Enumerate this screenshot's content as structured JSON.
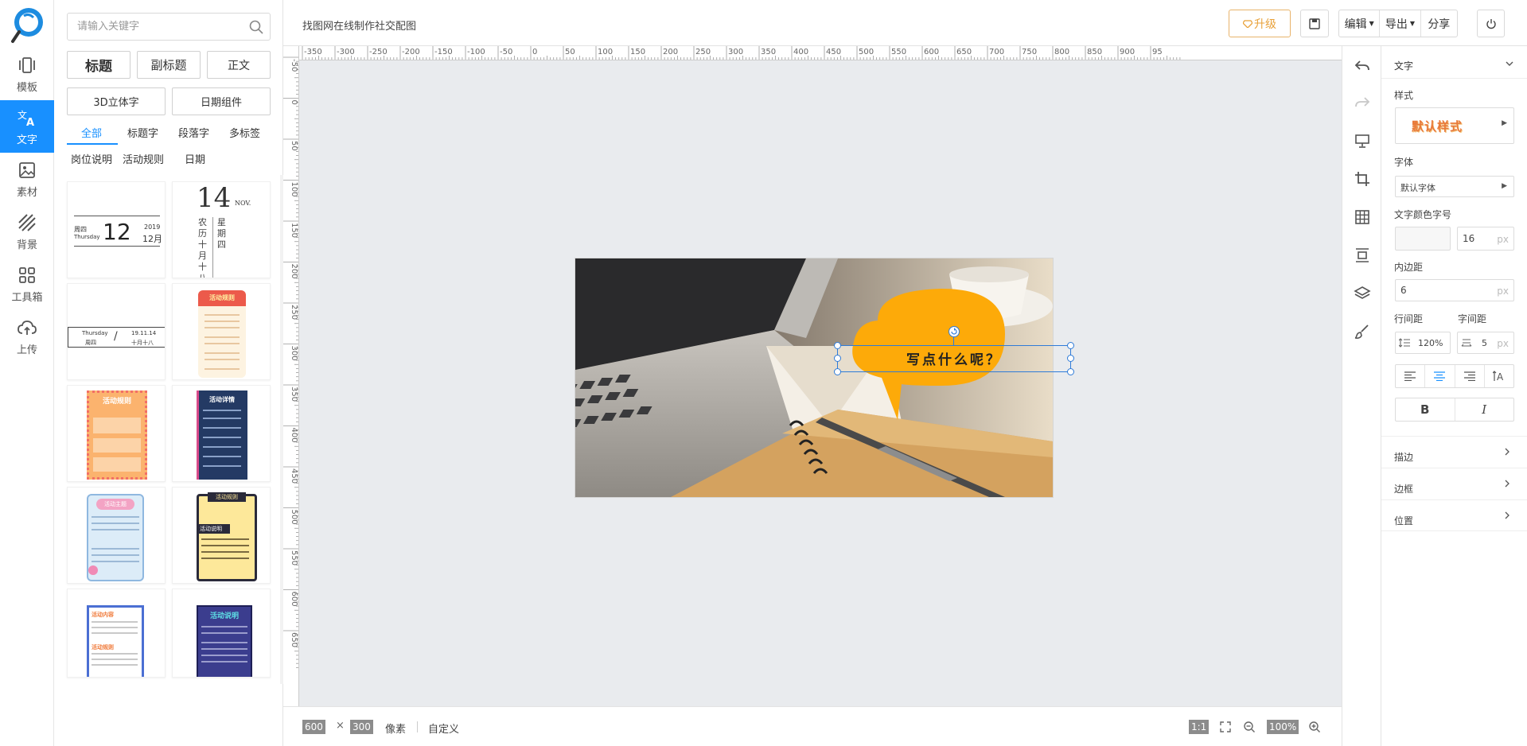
{
  "nav": {
    "items": [
      {
        "label": "模板",
        "icon": "template-icon"
      },
      {
        "label": "文字",
        "icon": "text-translate-icon",
        "active": true
      },
      {
        "label": "素材",
        "icon": "image-icon"
      },
      {
        "label": "背景",
        "icon": "background-stripes-icon"
      },
      {
        "label": "工具箱",
        "icon": "grid-toolbox-icon"
      },
      {
        "label": "上传",
        "icon": "cloud-upload-icon"
      }
    ]
  },
  "panel": {
    "search_placeholder": "请输入关键字",
    "buttons": {
      "title": "标题",
      "subtitle": "副标题",
      "body": "正文",
      "text3d": "3D立体字",
      "date": "日期组件"
    },
    "categories": [
      "全部",
      "标题字",
      "段落字",
      "多标签",
      "岗位说明",
      "活动规则",
      "日期"
    ],
    "active_category": "全部",
    "card1": {
      "weekday_cn": "周四",
      "weekday_en": "Thursday",
      "day": "12",
      "year": "2019",
      "month": "12月"
    },
    "card2": {
      "day": "14",
      "month": "NOV.",
      "lunar": "农历十月十八",
      "week": "星期四"
    },
    "card3": {
      "weekday_en": "Thursday",
      "weekday_cn": "周四",
      "date": "19.11.14",
      "lunar": "十月十八"
    },
    "card4": {
      "title": "活动规则"
    },
    "card5": {
      "title": "活动规则"
    },
    "card6": {
      "title": "活动详情"
    },
    "card7": {
      "title": "活动主题"
    },
    "card8": {
      "title": "活动规则",
      "section": "活动说明"
    },
    "card9": {
      "title": "活动内容",
      "section": "活动规则"
    },
    "card10": {
      "title": "活动说明"
    }
  },
  "topbar": {
    "doc_title": "找图网在线制作社交配图",
    "upgrade": "升级",
    "edit": "编辑",
    "export": "导出",
    "share": "分享"
  },
  "ruler": {
    "h_labels": [
      "-350",
      "-300",
      "-250",
      "-200",
      "-150",
      "-100",
      "-50",
      "0",
      "50",
      "100",
      "150",
      "200",
      "250",
      "300",
      "350",
      "400",
      "450",
      "500",
      "550",
      "600",
      "650",
      "700",
      "750",
      "800",
      "850",
      "900",
      "95"
    ],
    "v_labels": [
      "-50",
      "0",
      "50",
      "100",
      "150",
      "200",
      "250",
      "300",
      "350",
      "400",
      "450",
      "500",
      "550",
      "600",
      "650"
    ]
  },
  "canvas": {
    "text": "写点什么呢？",
    "bubble_color": "#fdaa09"
  },
  "bottom": {
    "width": "600",
    "times": "×",
    "height": "300",
    "unit": "像素",
    "custom": "自定义",
    "ratio": "1:1",
    "zoom": "100%"
  },
  "props": {
    "header": "文字",
    "style_label": "样式",
    "style_preview": "默认样式",
    "font_label": "字体",
    "font_value": "默认字体",
    "color_size_label": "文字颜色字号",
    "font_size": "16",
    "unit": "px",
    "padding_label": "内边距",
    "padding": "6",
    "line_height_label": "行间距",
    "line_height": "120%",
    "letter_spacing_label": "字间距",
    "letter_spacing": "5",
    "bold": "B",
    "italic": "I",
    "sections": [
      "描边",
      "边框",
      "位置"
    ]
  },
  "colors": {
    "accent": "#1890ff",
    "upgrade": "#e8a139",
    "selection": "#2f7bd8"
  }
}
